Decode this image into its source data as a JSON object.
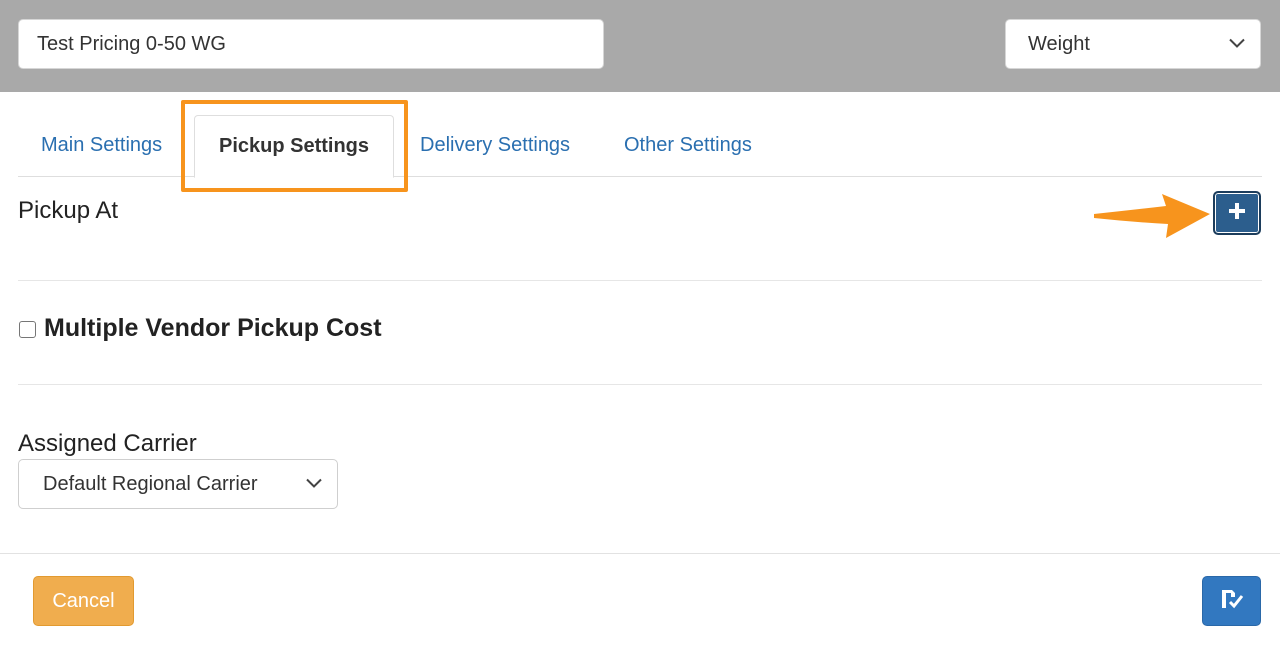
{
  "header": {
    "name_value": "Test Pricing 0-50 WG",
    "type_select": {
      "selected": "Weight",
      "icon": "chevron-down-icon"
    }
  },
  "tabs": [
    {
      "label": "Main Settings",
      "active": false
    },
    {
      "label": "Pickup Settings",
      "active": true
    },
    {
      "label": "Delivery Settings",
      "active": false
    },
    {
      "label": "Other Settings",
      "active": false
    }
  ],
  "pickup": {
    "pickup_at_title": "Pickup At",
    "add_icon": "plus-icon",
    "multiple_vendor_label": "Multiple Vendor Pickup Cost",
    "multiple_vendor_checked": false,
    "assigned_carrier_title": "Assigned Carrier",
    "carrier_select": {
      "selected": "Default Regional Carrier",
      "icon": "chevron-down-icon"
    }
  },
  "footer": {
    "cancel_label": "Cancel",
    "save_icon": "save-check-icon"
  },
  "annotation": {
    "color": "#f7941d"
  }
}
